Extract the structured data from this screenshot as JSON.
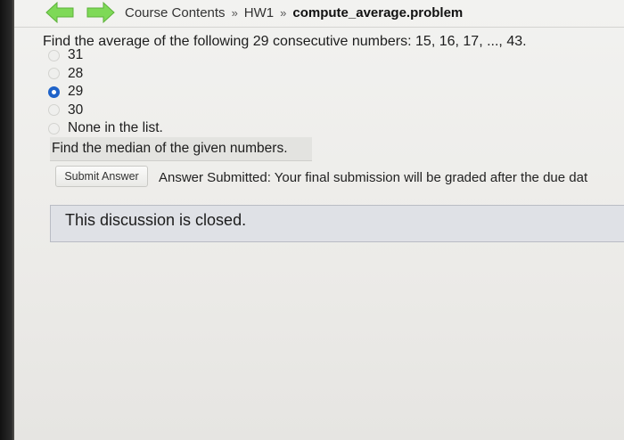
{
  "header": {
    "breadcrumb": [
      "Course Contents",
      "HW1",
      "compute_average.problem"
    ],
    "separator": "»"
  },
  "question": {
    "prompt": "Find the average of the following 29 consecutive numbers: 15, 16, 17, ..., 43.",
    "choices": [
      {
        "label": "31",
        "selected": false
      },
      {
        "label": "28",
        "selected": false
      },
      {
        "label": "29",
        "selected": true
      },
      {
        "label": "30",
        "selected": false
      },
      {
        "label": "None in the list.",
        "selected": false
      }
    ],
    "followup": "Find the median of the given numbers."
  },
  "submission": {
    "button_label": "Submit Answer",
    "status": "Answer Submitted: Your final submission will be graded after the due dat"
  },
  "discussion": {
    "closed_text": "This discussion is closed."
  },
  "colors": {
    "nav_arrow": "#7ed957",
    "radio_selected": "#1f63c9"
  }
}
